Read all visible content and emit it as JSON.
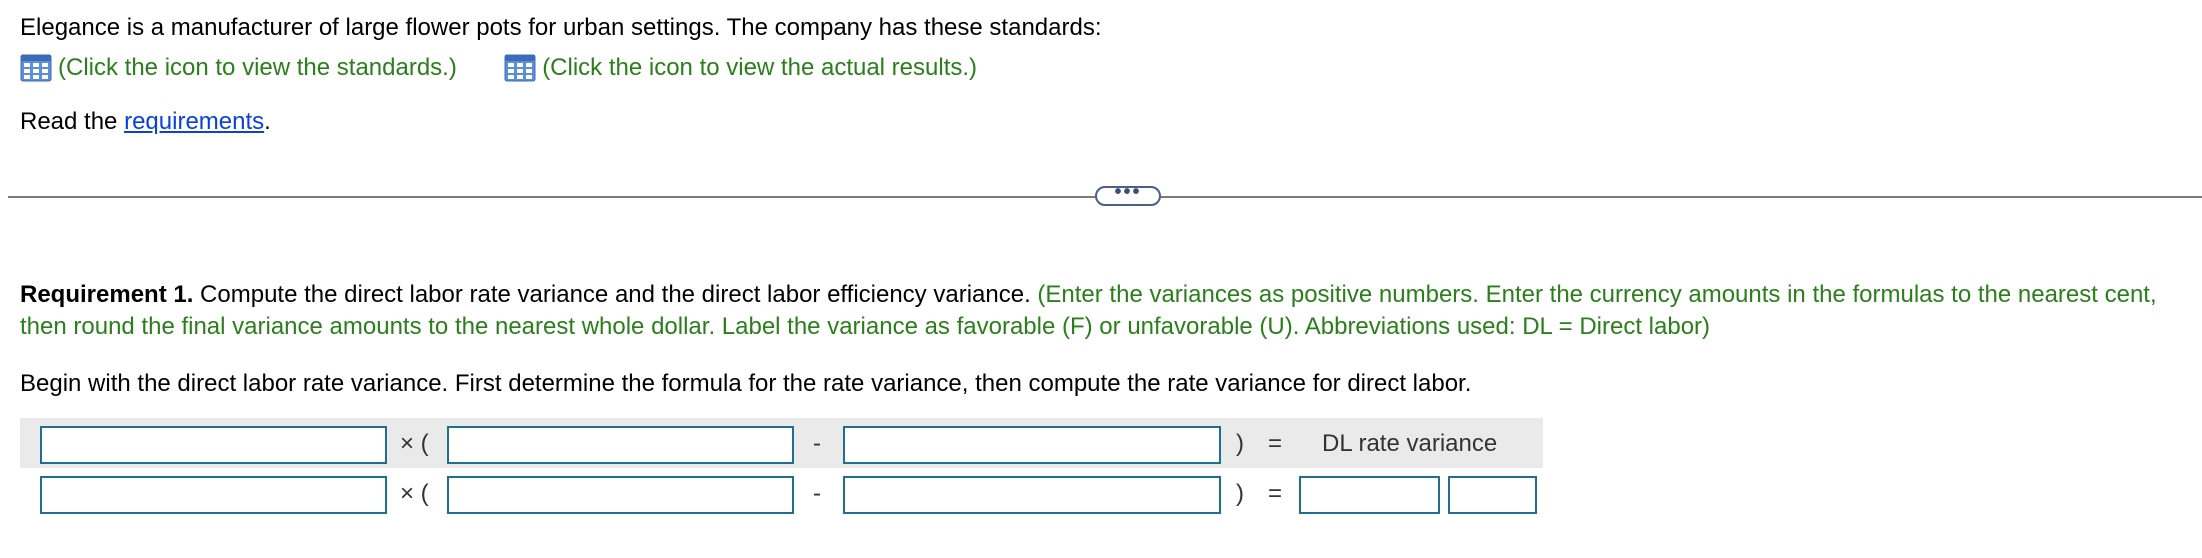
{
  "intro": {
    "text": "Elegance is a manufacturer of large flower pots for urban settings. The company has these standards:",
    "standards_link": "(Click the icon to view the standards.)",
    "actual_link": "(Click the icon to view the actual results.)",
    "read_prefix": "Read the ",
    "requirements_link": "requirements",
    "read_suffix": "."
  },
  "divider": {
    "expand_label": "•••"
  },
  "requirement": {
    "heading": "Requirement 1.",
    "body": " Compute the direct labor rate variance and the direct labor efficiency variance. ",
    "instructions": "(Enter the variances as positive numbers. Enter the currency amounts in the formulas to the nearest cent, then round the final variance amounts to the nearest whole dollar. Label the variance as favorable (F) or unfavorable (U). Abbreviations used: DL = Direct labor)",
    "begin_text": "Begin with the direct labor rate variance. First determine the formula for the rate variance, then compute the rate variance for direct labor."
  },
  "formula": {
    "times_open": "× (",
    "minus": "-",
    "close_equals": ")",
    "equals": "=",
    "result_label": "DL rate variance",
    "row1": {
      "input1": "",
      "input2": "",
      "input3": ""
    },
    "row2": {
      "input1": "",
      "input2": "",
      "input3": "",
      "amount": "",
      "label": ""
    }
  },
  "colors": {
    "instruction_green": "#2a7f1b",
    "link_blue": "#0b3fe0",
    "input_border": "#1f6f8f",
    "row_shade": "#eaeaea"
  }
}
